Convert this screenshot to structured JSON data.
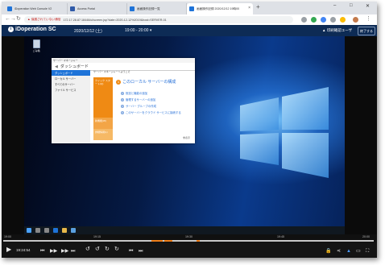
{
  "browser": {
    "tabs": [
      {
        "label": "iDoperation Web Console V2",
        "color": "#1e73d8",
        "active": false
      },
      {
        "label": "Access Portal",
        "color": "#2f5aa8",
        "active": false
      },
      {
        "label": "画面操作記録一覧",
        "color": "#1e73d8",
        "active": false
      },
      {
        "label": "画面操作記録 2020/12/12 19時00",
        "color": "#1e73d8",
        "active": true
      }
    ],
    "new_tab_icon": "plus-icon",
    "address": {
      "warning": "保護されていない通信",
      "url": "172.17.28.87:18446/ui/screen.jsp?date=2020-12-12%2019&host=SERVER-01"
    }
  },
  "app": {
    "logo_text": "iDoperation SC",
    "date": "2020/12/12 (土)",
    "time_range": "19:00 - 20:00 ▾",
    "user": "▲ 印刷確認ユーザ",
    "exit_label": "終了する"
  },
  "desktop": {
    "recycle_label": "ごみ箱",
    "server_manager": {
      "title": "サーバー マネージャー",
      "header": "ダッシュボード",
      "nav": [
        "ダッシュボード",
        "ローカル サーバー",
        "すべてのサーバー",
        "ファイル サービス"
      ],
      "welcome": "サーバー マネージャーへようこそ",
      "quick_start": "クイック スタート(Q)",
      "whats_new": "新機能(W)",
      "learn_more": "詳細情報(L)",
      "main_step": "このローカル サーバーの構成",
      "steps": [
        "役割と機能の追加",
        "管理するサーバーの追加",
        "サーバー グループの作成",
        "このサーバーをクラウド サービスに接続する"
      ],
      "hide": "非表示"
    }
  },
  "timeline": {
    "ticks": [
      "19:00",
      "19:15",
      "19:30",
      "19:45",
      "20:00"
    ],
    "segments_color": "#ef7f1a"
  },
  "player": {
    "current_time": "19:24:54",
    "play_icon": "play-icon"
  },
  "colors": {
    "header_bg": "#0d2b55",
    "accent_orange": "#ef8a14"
  }
}
